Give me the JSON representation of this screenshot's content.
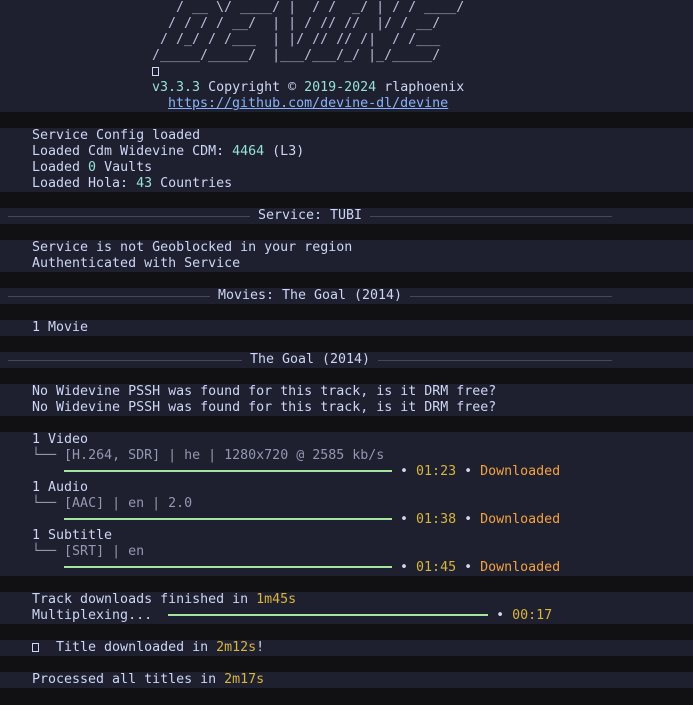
{
  "banner": {
    "ascii_art": [
      "   / __ \\/ ____/ |  / /  _/ | / / ____/",
      "  / / / / __/  | | / // //  |/ / __/",
      " / /_/ / /___  | |/ // // /|  / /___",
      "/_____/_____/  |___/___/_/ |_/_____/"
    ],
    "icon": "missing-glyph-box-icon",
    "version": "v3.3.3",
    "copyright": "Copyright ©",
    "years": "2019-2024",
    "author": "rlaphoenix",
    "url": "https://github.com/devine-dl/devine"
  },
  "config": {
    "line1": "Service Config loaded",
    "cdm_prefix": "Loaded Cdm Widevine CDM: ",
    "cdm_id": "4464",
    "cdm_level": " (L3)",
    "vaults_prefix": "Loaded ",
    "vaults_count": "0",
    "vaults_suffix": " Vaults",
    "hola_prefix": "Loaded Hola: ",
    "hola_count": "43",
    "hola_suffix": " Countries"
  },
  "service_rule": "Service: TUBI",
  "service": {
    "line1": "Service is not Geoblocked in your region",
    "line2": "Authenticated with Service"
  },
  "movies_rule": "Movies: The Goal (2014)",
  "movies": {
    "count": "1 Movie"
  },
  "title_rule": "The Goal (2014)",
  "warnings": [
    "No Widevine PSSH was found for this track, is it DRM free?",
    "No Widevine PSSH was found for this track, is it DRM free?"
  ],
  "tracks": [
    {
      "heading": "1 Video",
      "detail": "[H.264, SDR] | he | 1280x720 @ 2585 kb/s",
      "progress": 100,
      "time": "01:23",
      "status": "Downloaded"
    },
    {
      "heading": "1 Audio",
      "detail": "[AAC] | en | 2.0",
      "progress": 100,
      "time": "01:38",
      "status": "Downloaded"
    },
    {
      "heading": "1 Subtitle",
      "detail": "[SRT] | en",
      "progress": 100,
      "time": "01:45",
      "status": "Downloaded"
    }
  ],
  "tree_glyph": "└──",
  "bullet": "•",
  "finish": {
    "prefix": "Track downloads finished in ",
    "time": "1m45s",
    "mux_label": "Multiplexing...",
    "mux_progress": 100,
    "mux_time": "00:17"
  },
  "title_done": {
    "icon": "missing-glyph-box-icon",
    "prefix": "Title downloaded in ",
    "time": "2m12s",
    "suffix": "!"
  },
  "processed": {
    "prefix": "Processed all titles in ",
    "time": "2m17s"
  },
  "colors": {
    "block_bg": "#1e1f2f",
    "accent_teal": "#94e2d5",
    "time_yellow": "#d9b53a",
    "status_orange": "#f5a340",
    "bar_green": "#a6e3a1"
  }
}
